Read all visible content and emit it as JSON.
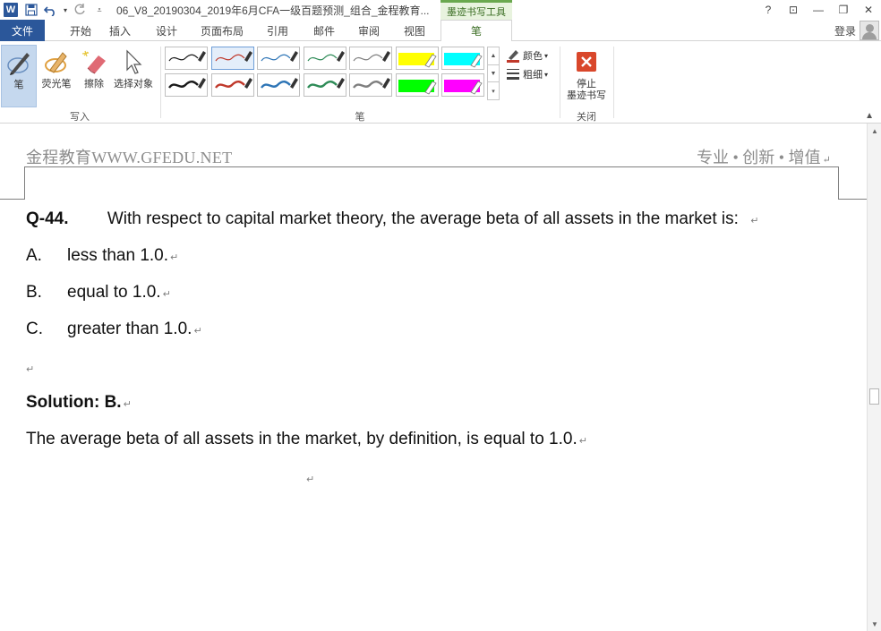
{
  "titlebar": {
    "doc_title": "06_V8_20190304_2019年6月CFA一级百题预测_组合_金程教育...",
    "context_tab": "墨迹书写工具",
    "help": "?",
    "ribbon_options": "⊡",
    "minimize": "—",
    "restore": "❐",
    "close": "✕"
  },
  "tabs": {
    "file": "文件",
    "home": "开始",
    "insert": "插入",
    "design": "设计",
    "layout": "页面布局",
    "references": "引用",
    "mailings": "邮件",
    "review": "审阅",
    "view": "视图",
    "pen": "笔",
    "login": "登录"
  },
  "ribbon": {
    "write_group": {
      "label": "写入",
      "pen": "笔",
      "highlighter": "荧光笔",
      "eraser": "擦除",
      "select": "选择对象"
    },
    "pens_group": {
      "label": "笔",
      "pens": [
        {
          "color": "#1a1a1a",
          "kind": "thin"
        },
        {
          "color": "#c0392b",
          "kind": "thin"
        },
        {
          "color": "#2e75b6",
          "kind": "thin"
        },
        {
          "color": "#2e8b57",
          "kind": "thin"
        },
        {
          "color": "#7f7f7f",
          "kind": "thin"
        },
        {
          "color": "#ffff00",
          "kind": "highlighter"
        },
        {
          "color": "#00ffff",
          "kind": "highlighter"
        },
        {
          "color": "#1a1a1a",
          "kind": "thick"
        },
        {
          "color": "#c0392b",
          "kind": "thick"
        },
        {
          "color": "#2e75b6",
          "kind": "thick"
        },
        {
          "color": "#2e8b57",
          "kind": "thick"
        },
        {
          "color": "#7f7f7f",
          "kind": "thick"
        },
        {
          "color": "#00ff00",
          "kind": "highlighter"
        },
        {
          "color": "#ff00ff",
          "kind": "highlighter"
        }
      ],
      "color": "颜色",
      "thickness": "粗细"
    },
    "close_group": {
      "label": "关闭",
      "stop": "停止\n墨迹书写"
    }
  },
  "document": {
    "header_left": "金程教育WWW.GFEDU.NET",
    "header_right": "专业 • 创新 • 增值",
    "question_number": "Q-44.",
    "question_text": "With respect to capital market theory, the average beta of all assets in the market is:",
    "options": [
      {
        "letter": "A.",
        "text": "less than 1.0."
      },
      {
        "letter": "B.",
        "text": "equal to 1.0."
      },
      {
        "letter": "C.",
        "text": "greater than 1.0."
      }
    ],
    "solution_label": "Solution: B.",
    "explanation": "The average beta of all assets in the market, by definition, is equal to 1.0.",
    "paragraph_mark": "↵"
  }
}
